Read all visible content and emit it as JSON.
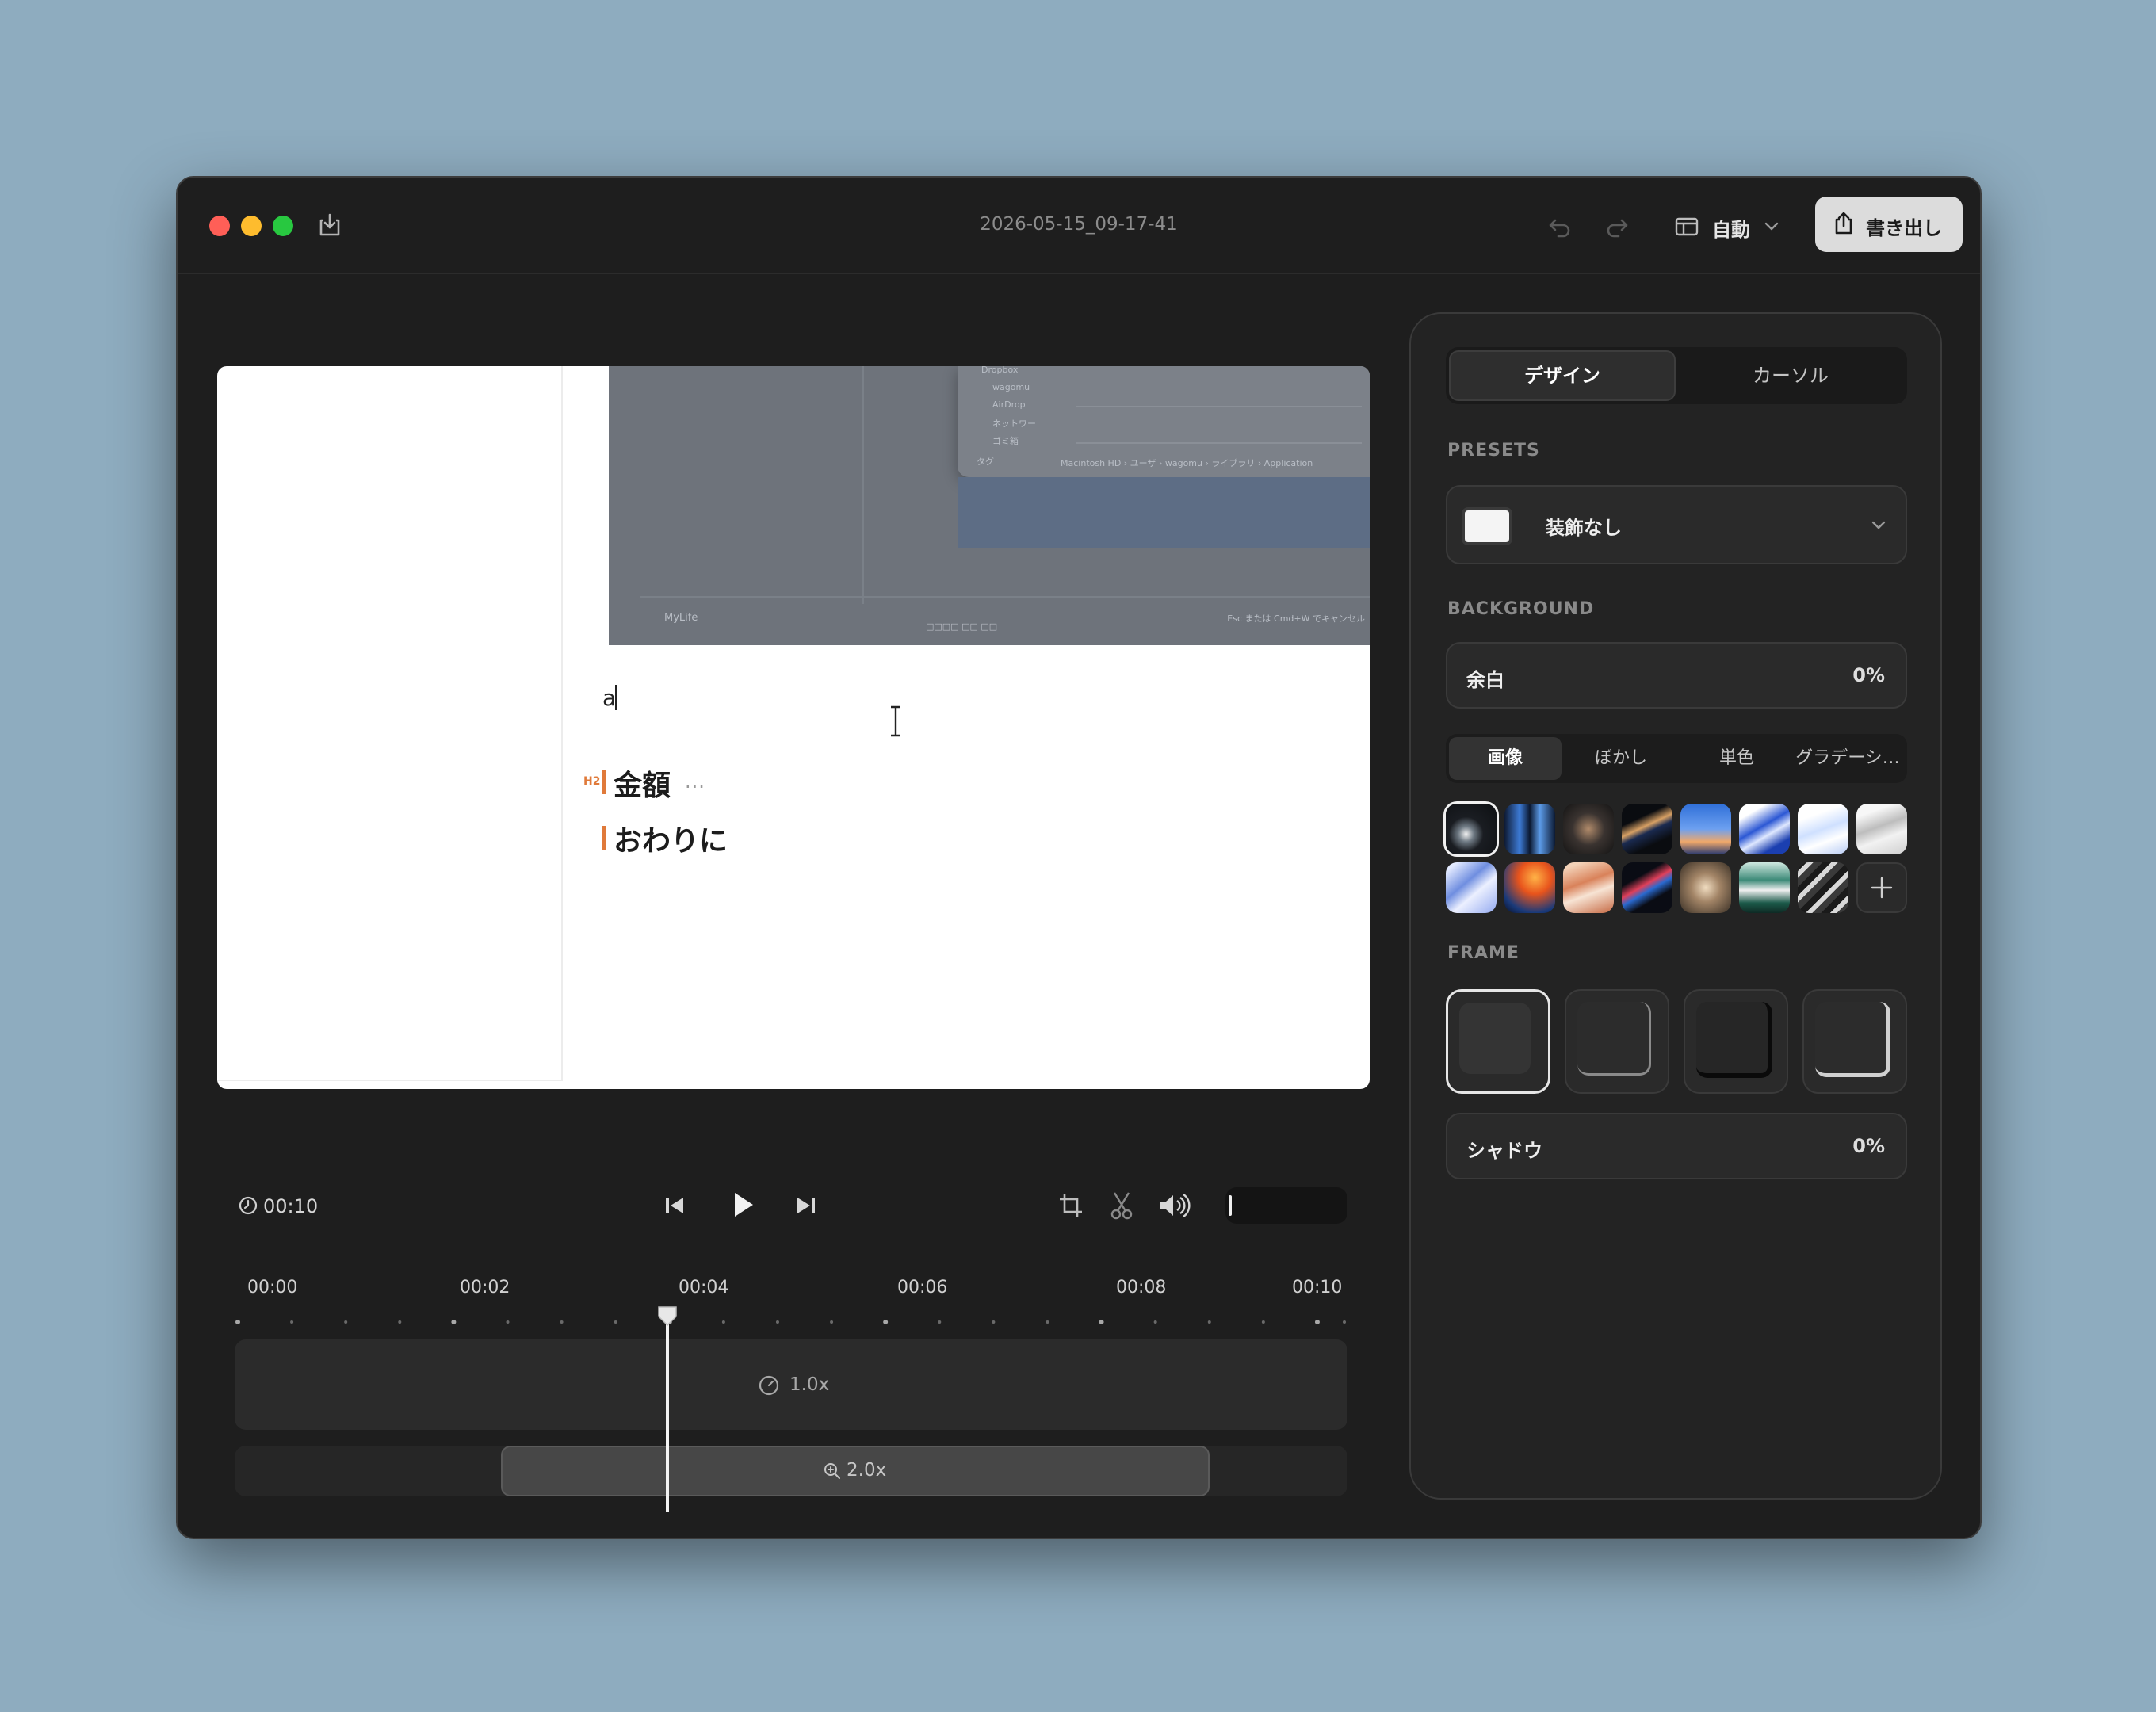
{
  "window": {
    "title": "2026-05-15_09-17-41",
    "layout_label": "自動",
    "export_label": "書き出し"
  },
  "canvas": {
    "screenshot_text": {
      "sidebar_items": [
        "Dropbox",
        "wagomu",
        "AirDrop",
        "ネットワー",
        "ゴミ箱"
      ],
      "tag_label": "タグ",
      "path_bar": "Macintosh HD › ユーザ › wagomu › ライブラリ › Application",
      "footer_left": "MyLife",
      "footer_hint": "Esc または Cmd+W でキャンセル",
      "footer_mid": "□□□□ □□ □□"
    },
    "typed_text": "a",
    "h2_tag": "H2",
    "heading_1": "金額",
    "heading_1_more": "...",
    "heading_2": "おわりに"
  },
  "transport": {
    "duration": "00:10"
  },
  "timeline": {
    "ticks": [
      "00:00",
      "00:02",
      "00:04",
      "00:06",
      "00:08",
      "00:10"
    ],
    "speed_label": "1.0x",
    "zoom_label": "2.0x",
    "playhead_seconds": 4.0,
    "zoom_segment_range": [
      2.4,
      8.9
    ]
  },
  "panel": {
    "tabs": [
      "デザイン",
      "カーソル"
    ],
    "active_tab": "デザイン",
    "presets_label": "PRESETS",
    "preset_value": "装飾なし",
    "background_label": "BACKGROUND",
    "padding_label": "余白",
    "padding_value": "0%",
    "bg_tabs": [
      "画像",
      "ぼかし",
      "単色",
      "グラデーシ…"
    ],
    "active_bg_tab": "画像",
    "frame_label": "FRAME",
    "shadow_label": "シャドウ",
    "shadow_value": "0%"
  },
  "colors": {
    "desktop": "#8eacbf",
    "window_bg": "#1e1e1e",
    "accent_heading": "#e07a3a",
    "export_button": "#dcdcdc"
  }
}
